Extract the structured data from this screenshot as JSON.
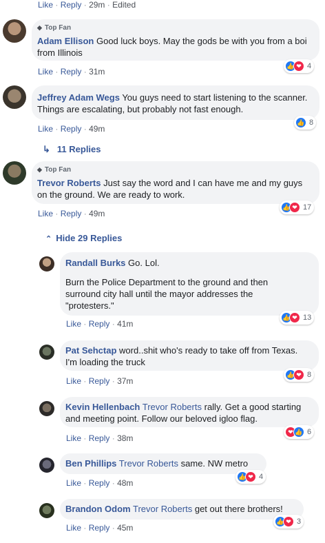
{
  "top_meta": {
    "like": "Like",
    "reply": "Reply",
    "time": "29m",
    "edited": "Edited"
  },
  "comments": [
    {
      "badge": "Top Fan",
      "name": "Adam Ellison",
      "text": "Good luck boys. May the gods be with you from a boi from Illinois",
      "like": "Like",
      "reply": "Reply",
      "time": "31m",
      "reactions": "4"
    },
    {
      "name": "Jeffrey Adam Wegs",
      "text": "You guys need to start listening to the scanner. Things are escalating, but probably not fast enough.",
      "like": "Like",
      "reply": "Reply",
      "time": "49m",
      "reactions": "8"
    },
    {
      "badge": "Top Fan",
      "name": "Trevor Roberts",
      "text": "Just say the word and I can have me and my guys on the ground. We are ready to work.",
      "like": "Like",
      "reply": "Reply",
      "time": "49m",
      "reactions": "17"
    }
  ],
  "replies_link_1": "11 Replies",
  "hide_replies": "Hide 29 Replies",
  "replies": [
    {
      "name": "Randall Burks",
      "text": "Go. Lol.",
      "text2": "Burn the Police Department to the ground and then surround city hall until the mayor addresses the \"protesters.\"",
      "like": "Like",
      "reply": "Reply",
      "time": "41m",
      "reactions": "13"
    },
    {
      "name": "Pat Sehctap",
      "text": "word..shit who's ready to take off from Texas. I'm loading the truck",
      "like": "Like",
      "reply": "Reply",
      "time": "37m",
      "reactions": "8"
    },
    {
      "name": "Kevin Hellenbach",
      "tag": "Trevor Roberts",
      "text": "rally. Get a good starting and meeting point. Follow our beloved igloo flag.",
      "like": "Like",
      "reply": "Reply",
      "time": "38m",
      "reactions": "6"
    },
    {
      "name": "Ben Phillips",
      "tag": "Trevor Roberts",
      "text": "same. NW metro",
      "like": "Like",
      "reply": "Reply",
      "time": "48m",
      "reactions": "4"
    },
    {
      "name": "Brandon Odom",
      "tag": "Trevor Roberts",
      "text": "get out there brothers!",
      "like": "Like",
      "reply": "Reply",
      "time": "45m",
      "reactions": "3"
    }
  ],
  "colors": {
    "link": "#385898",
    "bubble": "#f2f3f5",
    "like": "#2078f4",
    "love": "#f0284a"
  }
}
